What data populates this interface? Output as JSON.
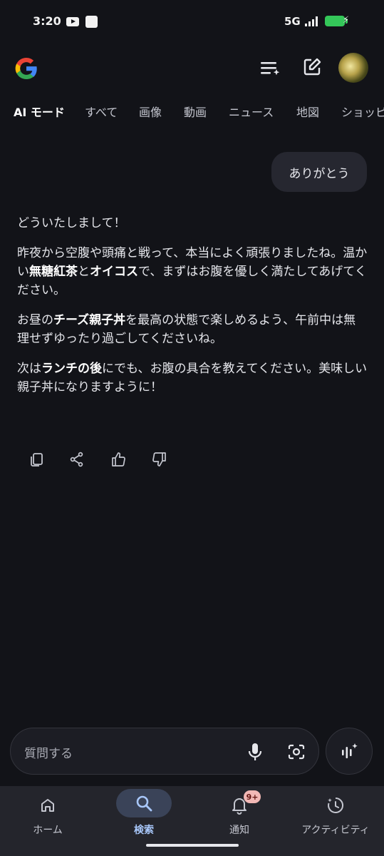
{
  "status_bar": {
    "time": "3:20",
    "network": "5G",
    "icons": [
      "youtube-icon",
      "app-notification-icon",
      "signal-icon",
      "battery-charging-icon"
    ]
  },
  "header": {
    "logo": "G",
    "icons": [
      "history-list-icon",
      "new-chat-edit-icon",
      "avatar"
    ]
  },
  "tabs": [
    {
      "label": "AI モード",
      "active": true
    },
    {
      "label": "すべて"
    },
    {
      "label": "画像"
    },
    {
      "label": "動画"
    },
    {
      "label": "ニュース"
    },
    {
      "label": "地図"
    },
    {
      "label": "ショッピ"
    }
  ],
  "chat": {
    "user_message": "ありがとう",
    "answer": {
      "p1": "どういたしまして！",
      "p2": {
        "a": "昨夜から空腹や頭痛と戦って、本当によく頑張りましたね。温かい",
        "b1": "無糖紅茶",
        "c": "と",
        "b2": "オイコス",
        "d": "で、まずはお腹を優しく満たしてあげてください。"
      },
      "p3": {
        "a": "お昼の",
        "b1": "チーズ親子丼",
        "c": "を最高の状態で楽しめるよう、午前中は無理せずゆったり過ごしてくださいね。"
      },
      "p4": {
        "a": "次は",
        "b1": "ランチの後",
        "c": "にでも、お腹の具合を教えてください。美味しい親子丼になりますように！"
      }
    },
    "actions": [
      "copy-icon",
      "share-icon",
      "thumbs-up-icon",
      "thumbs-down-icon"
    ]
  },
  "input": {
    "placeholder": "質問する",
    "icons": [
      "mic-icon",
      "lens-camera-icon",
      "live-voice-icon"
    ]
  },
  "bottom_nav": [
    {
      "label": "ホーム",
      "icon": "home-icon"
    },
    {
      "label": "検索",
      "icon": "search-icon",
      "active": true
    },
    {
      "label": "通知",
      "icon": "bell-icon",
      "badge": "9+"
    },
    {
      "label": "アクティビティ",
      "icon": "activity-icon"
    }
  ],
  "colors": {
    "background": "#121318",
    "accent": "#a8c7fa",
    "badge": "#f2b8b5"
  }
}
